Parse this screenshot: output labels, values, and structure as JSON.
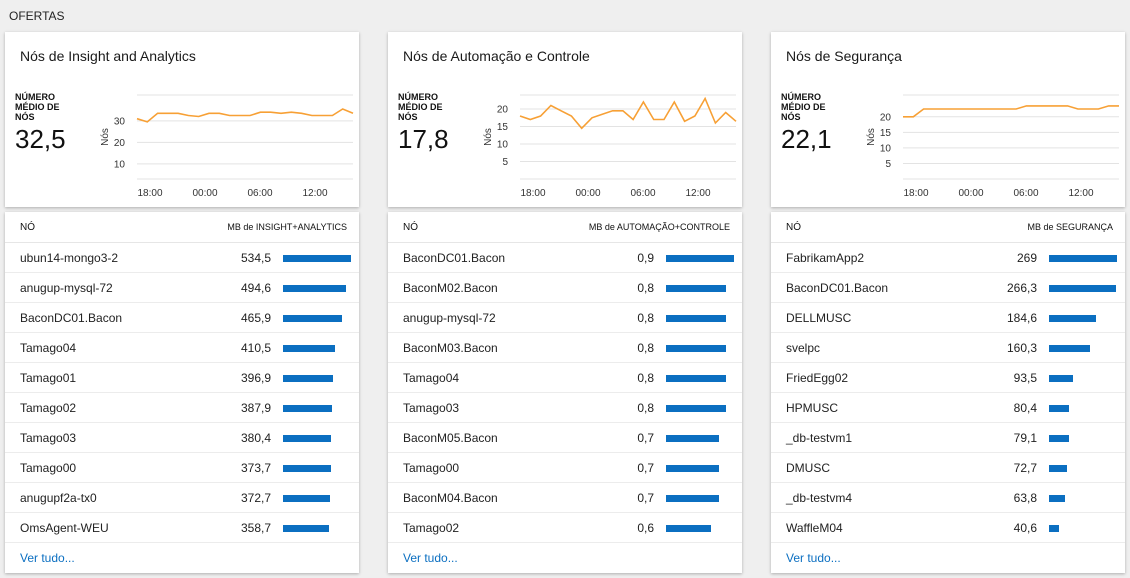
{
  "section_title": "OFERTAS",
  "colors": {
    "accent": "#0b6fc1",
    "trend": "#f7a035"
  },
  "cards": [
    {
      "title": "Nós de Insight and Analytics",
      "metric_label": "NÚMERO MÉDIO DE NÓS",
      "metric_value": "32,5",
      "chart_data": {
        "type": "line",
        "ylabel": "Nós",
        "yticks": [
          10,
          20,
          30
        ],
        "ylim": [
          3,
          42
        ],
        "xticks": [
          "18:00",
          "00:00",
          "06:00",
          "12:00"
        ],
        "x": [
          0,
          1,
          2,
          3,
          4,
          5,
          6,
          7,
          8,
          9,
          10,
          11,
          12,
          13,
          14,
          15,
          16,
          17,
          18,
          19,
          20,
          21
        ],
        "values": [
          31,
          29.5,
          33.5,
          33.5,
          33.5,
          32.5,
          32,
          33.5,
          33.5,
          32.5,
          32.5,
          32.5,
          34,
          34,
          33.5,
          34,
          33.5,
          32.5,
          32.5,
          32.5,
          35.5,
          33.5
        ]
      },
      "table": {
        "col_node": "NÓ",
        "col_mb": "MB de INSIGHT+ANALYTICS",
        "max": 534.5,
        "rows": [
          {
            "name": "ubun14-mongo3-2",
            "value": "534,5",
            "num": 534.5
          },
          {
            "name": "anugup-mysql-72",
            "value": "494,6",
            "num": 494.6
          },
          {
            "name": "BaconDC01.Bacon",
            "value": "465,9",
            "num": 465.9
          },
          {
            "name": "Tamago04",
            "value": "410,5",
            "num": 410.5
          },
          {
            "name": "Tamago01",
            "value": "396,9",
            "num": 396.9
          },
          {
            "name": "Tamago02",
            "value": "387,9",
            "num": 387.9
          },
          {
            "name": "Tamago03",
            "value": "380,4",
            "num": 380.4
          },
          {
            "name": "Tamago00",
            "value": "373,7",
            "num": 373.7
          },
          {
            "name": "anugupf2a-tx0",
            "value": "372,7",
            "num": 372.7
          },
          {
            "name": "OmsAgent-WEU",
            "value": "358,7",
            "num": 358.7
          }
        ]
      },
      "see_all": "Ver tudo..."
    },
    {
      "title": "Nós de Automação e Controle",
      "metric_label": "NÚMERO MÉDIO DE NÓS",
      "metric_value": "17,8",
      "chart_data": {
        "type": "line",
        "ylabel": "Nós",
        "yticks": [
          5,
          10,
          15,
          20
        ],
        "ylim": [
          0,
          24
        ],
        "xticks": [
          "18:00",
          "00:00",
          "06:00",
          "12:00"
        ],
        "x": [
          0,
          1,
          2,
          3,
          4,
          5,
          6,
          7,
          8,
          9,
          10,
          11,
          12,
          13,
          14,
          15,
          16,
          17,
          18,
          19,
          20,
          21
        ],
        "values": [
          18,
          17,
          18,
          21,
          19.5,
          18,
          14.5,
          17.5,
          18.5,
          19.5,
          19.5,
          17,
          22,
          17,
          17,
          22,
          16.5,
          18,
          23,
          16,
          19,
          16.5
        ]
      },
      "table": {
        "col_node": "NÓ",
        "col_mb": "MB de AUTOMAÇÃO+CONTROLE",
        "max": 0.9,
        "rows": [
          {
            "name": "BaconDC01.Bacon",
            "value": "0,9",
            "num": 0.9
          },
          {
            "name": "BaconM02.Bacon",
            "value": "0,8",
            "num": 0.8
          },
          {
            "name": "anugup-mysql-72",
            "value": "0,8",
            "num": 0.8
          },
          {
            "name": "BaconM03.Bacon",
            "value": "0,8",
            "num": 0.8
          },
          {
            "name": "Tamago04",
            "value": "0,8",
            "num": 0.8
          },
          {
            "name": "Tamago03",
            "value": "0,8",
            "num": 0.8
          },
          {
            "name": "BaconM05.Bacon",
            "value": "0,7",
            "num": 0.7
          },
          {
            "name": "Tamago00",
            "value": "0,7",
            "num": 0.7
          },
          {
            "name": "BaconM04.Bacon",
            "value": "0,7",
            "num": 0.7
          },
          {
            "name": "Tamago02",
            "value": "0,6",
            "num": 0.6
          }
        ]
      },
      "see_all": "Ver tudo..."
    },
    {
      "title": "Nós de Segurança",
      "metric_label": "NÚMERO MÉDIO DE NÓS",
      "metric_value": "22,1",
      "chart_data": {
        "type": "line",
        "ylabel": "Nós",
        "yticks": [
          5,
          10,
          15,
          20
        ],
        "ylim": [
          0,
          27
        ],
        "xticks": [
          "18:00",
          "00:00",
          "06:00",
          "12:00"
        ],
        "x": [
          0,
          1,
          2,
          3,
          4,
          5,
          6,
          7,
          8,
          9,
          10,
          11,
          12,
          13,
          14,
          15,
          16,
          17,
          18,
          19,
          20,
          21
        ],
        "values": [
          20,
          20,
          22.5,
          22.5,
          22.5,
          22.5,
          22.5,
          22.5,
          22.5,
          22.5,
          22.5,
          22.5,
          23.5,
          23.5,
          23.5,
          23.5,
          23.5,
          22.5,
          22.5,
          22.5,
          23.5,
          23.5
        ]
      },
      "table": {
        "col_node": "NÓ",
        "col_mb": "MB de SEGURANÇA",
        "max": 269,
        "rows": [
          {
            "name": "FabrikamApp2",
            "value": "269",
            "num": 269
          },
          {
            "name": "BaconDC01.Bacon",
            "value": "266,3",
            "num": 266.3
          },
          {
            "name": "DELLMUSC",
            "value": "184,6",
            "num": 184.6
          },
          {
            "name": "svelpc",
            "value": "160,3",
            "num": 160.3
          },
          {
            "name": "FriedEgg02",
            "value": "93,5",
            "num": 93.5
          },
          {
            "name": "HPMUSC",
            "value": "80,4",
            "num": 80.4
          },
          {
            "name": "_db-testvm1",
            "value": "79,1",
            "num": 79.1
          },
          {
            "name": "DMUSC",
            "value": "72,7",
            "num": 72.7
          },
          {
            "name": "_db-testvm4",
            "value": "63,8",
            "num": 63.8
          },
          {
            "name": "WaffleM04",
            "value": "40,6",
            "num": 40.6
          }
        ]
      },
      "see_all": "Ver tudo..."
    }
  ]
}
